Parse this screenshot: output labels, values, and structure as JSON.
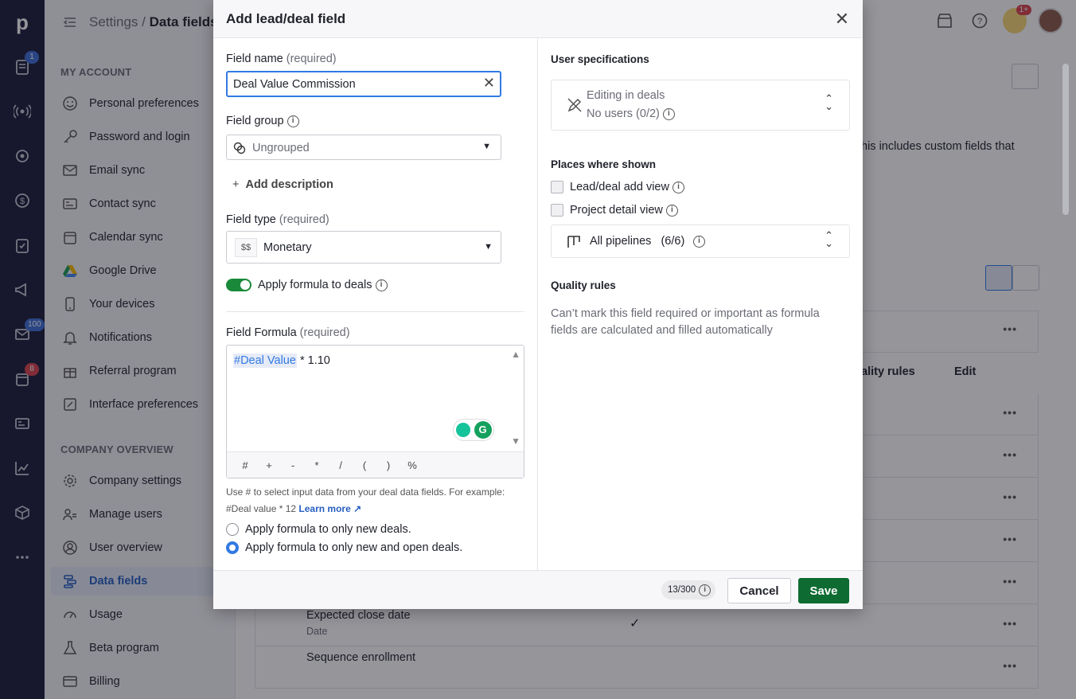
{
  "rail": {
    "logo": "p",
    "badges": {
      "deals": "1",
      "mail": "100",
      "calendar": "8"
    }
  },
  "sidebar": {
    "breadcrumb_root": "Settings",
    "breadcrumb_sep": "/",
    "breadcrumb_current": "Data fields",
    "my_account_title": "MY ACCOUNT",
    "my_account_items": [
      {
        "label": "Personal preferences",
        "icon": "smile-icon"
      },
      {
        "label": "Password and login",
        "icon": "key-icon"
      },
      {
        "label": "Email sync",
        "icon": "envelope-icon"
      },
      {
        "label": "Contact sync",
        "icon": "contact-card-icon"
      },
      {
        "label": "Calendar sync",
        "icon": "calendar-icon"
      },
      {
        "label": "Google Drive",
        "icon": "google-drive-icon"
      },
      {
        "label": "Your devices",
        "icon": "phone-icon"
      },
      {
        "label": "Notifications",
        "icon": "bell-icon"
      },
      {
        "label": "Referral program",
        "icon": "gift-icon"
      },
      {
        "label": "Interface preferences",
        "icon": "interface-icon"
      }
    ],
    "company_title": "COMPANY OVERVIEW",
    "company_items": [
      {
        "label": "Company settings",
        "icon": "gear-icon"
      },
      {
        "label": "Manage users",
        "icon": "users-icon"
      },
      {
        "label": "User overview",
        "icon": "user-circle-icon"
      },
      {
        "label": "Data fields",
        "icon": "data-fields-icon",
        "active": true
      },
      {
        "label": "Usage",
        "icon": "gauge-icon"
      },
      {
        "label": "Beta program",
        "icon": "flask-icon"
      },
      {
        "label": "Billing",
        "icon": "credit-card-icon"
      }
    ]
  },
  "topbar": {
    "notif_badge": "1+"
  },
  "background": {
    "description_snippet": "his includes custom fields that",
    "col_quality_rules": "ality rules",
    "col_edit": "Edit",
    "row_expected_close": "Expected close date",
    "row_expected_close_type": "Date",
    "row_sequence": "Sequence enrollment"
  },
  "modal": {
    "title": "Add lead/deal field",
    "field_name": {
      "label": "Field name",
      "req": "(required)",
      "value": "Deal Value Commission"
    },
    "field_group": {
      "label": "Field group",
      "value": "Ungrouped"
    },
    "add_description": "Add description",
    "field_type": {
      "label": "Field type",
      "req": "(required)",
      "value": "Monetary",
      "icon_text": "$$"
    },
    "apply_formula_label": "Apply formula to deals",
    "formula": {
      "label": "Field Formula",
      "req": "(required)",
      "tag": "#Deal Value",
      "rest": " * 1.10",
      "operators": [
        "#",
        "+",
        "-",
        "*",
        "/",
        "(",
        ")",
        "%"
      ]
    },
    "helper_text": "Use # to select input data from your deal data fields. For example: #Deal value * 12",
    "learn_more": "Learn more",
    "radio_new": "Apply formula to only new deals.",
    "radio_new_open": "Apply formula to only new and open deals.",
    "user_specs": {
      "title": "User specifications",
      "editing": "Editing in deals",
      "users": "No users (0/2)"
    },
    "places": {
      "title": "Places where shown",
      "add_view": "Lead/deal add view",
      "project_view": "Project detail view",
      "pipelines": "All pipelines   (6/6)"
    },
    "quality": {
      "title": "Quality rules",
      "text": "Can’t mark this field required or important as formula fields are calculated and filled automatically"
    },
    "footer": {
      "counter": "13/300",
      "cancel": "Cancel",
      "save": "Save"
    }
  }
}
